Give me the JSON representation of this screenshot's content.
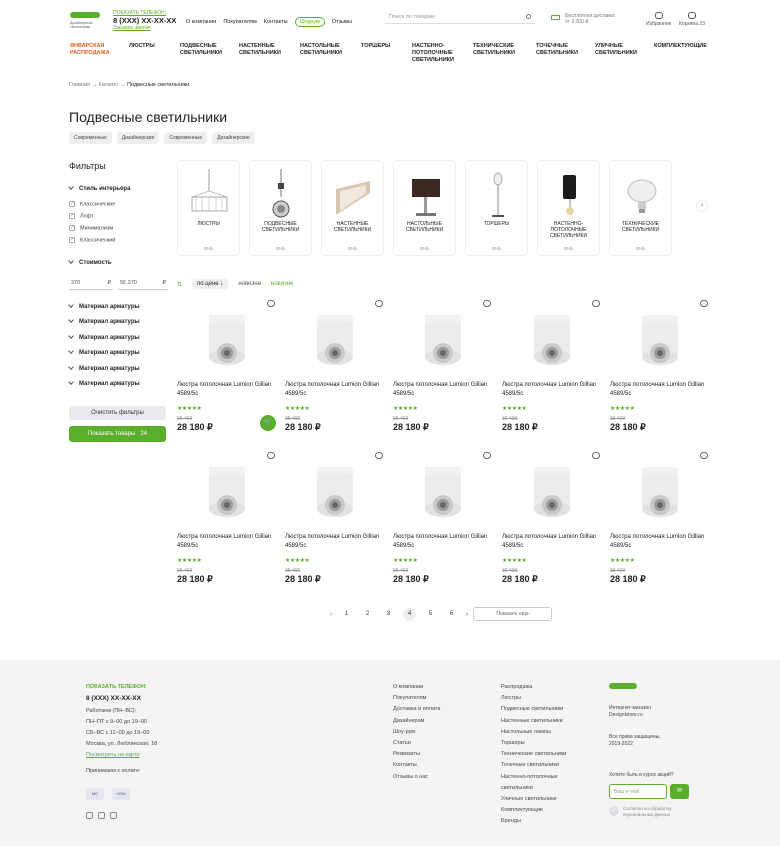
{
  "header": {
    "logo_sub": "Дизайнерские светильники",
    "phone_label": "ПОКАЗАТЬ ТЕЛЕФОН:",
    "phone": "8 (XXX) XX-XX-XX",
    "callback": "Заказать звонок",
    "nav": [
      "О компании",
      "Покупателям",
      "Контакты",
      "Шоурум",
      "Отзывы"
    ],
    "search_placeholder": "Поиск по товарам",
    "delivery": [
      "Бесплатная доставка",
      "от 3 000 ₽"
    ],
    "favorites": "Избранное",
    "cart": "Корзина 23"
  },
  "menu": [
    "ЯНВАРСКАЯ РАСПРОДАЖА",
    "ЛЮСТРЫ",
    "ПОДВЕСНЫЕ СВЕТИЛЬНИКИ",
    "НАСТЕННЫЕ СВЕТИЛЬНИКИ",
    "НАСТОЛЬНЫЕ СВЕТИЛЬНИКИ",
    "ТОРШЕРЫ",
    "НАСТЕННО-ПОТОЛОЧНЫЕ СВЕТИЛЬНИКИ",
    "ТЕХНИЧЕСКИЕ СВЕТИЛЬНИКИ",
    "ТОЧЕЧНЫЕ СВЕТИЛЬНИКИ",
    "УЛИЧНЫЕ СВЕТИЛЬНИКИ",
    "КОМПЛЕКТУЮЩИЕ"
  ],
  "breadcrumb": {
    "home": "Главная",
    "catalog": "Каталог",
    "current": "Подвесные светильники"
  },
  "title": "Подвесные светильники",
  "tags": [
    "Современные",
    "Дизайнерские",
    "Современные",
    "Дизайнерские"
  ],
  "filters": {
    "heading": "Фильтры",
    "style_group": "Стиль интерьера",
    "styles": [
      "Классические",
      "Лофт",
      "Минимализм",
      "Классический"
    ],
    "price_group": "Стоимость",
    "price_from": "370",
    "price_to": "56 370",
    "currency": "₽",
    "material_groups": [
      "Материал арматуры",
      "Материал арматуры",
      "Материал арматуры",
      "Материал арматуры",
      "Материал арматуры",
      "Материал арматуры"
    ],
    "clear": "Очистить фильтры",
    "show": "Показать товары",
    "show_count": "24"
  },
  "categories": [
    {
      "name": "ЛЮСТРЫ",
      "count": "384k"
    },
    {
      "name": "ПОДВЕСНЫЕ СВЕТИЛЬНИКИ",
      "count": "384k"
    },
    {
      "name": "НАСТЕННЫЕ СВЕТИЛЬНИКИ",
      "count": "384k"
    },
    {
      "name": "НАСТОЛЬНЫЕ СВЕТИЛЬНИКИ",
      "count": "384k"
    },
    {
      "name": "ТОРШЕРЫ",
      "count": "384k"
    },
    {
      "name": "НАСТЕННО-ПОТОЛОЧНЫЕ СВЕТИЛЬНИКИ",
      "count": "384k"
    },
    {
      "name": "ТЕХНИЧЕСКИЕ СВЕТИЛЬНИКИ",
      "count": "384k"
    }
  ],
  "sort": {
    "label": "по цене ↓",
    "newest": "новизне",
    "popular": "новизне"
  },
  "product": {
    "name": "Люстра потолочная Lumion Gillian 4589/5c",
    "stars": "★★★★★",
    "old_price": "35 490",
    "price": "28 180 ₽"
  },
  "pagination": {
    "pages": [
      "1",
      "2",
      "3",
      "4",
      "5",
      "6"
    ],
    "active": "4",
    "prev": "‹",
    "next": "›",
    "more": "Показать еще"
  },
  "footer": {
    "phone_label": "Показать телефон:",
    "phone": "8 (XXX) XX-XX-XX",
    "hours": [
      "Работаем (ПН–ВС):",
      "ПН–ПТ с 9–00 до 19–00",
      "СБ–ВС с 11–00 до 19–00",
      "Москва, ул. Люблинская, 18"
    ],
    "map": "Посмотреть на карте",
    "pay_label": "Принимаем к оплате:",
    "pay": [
      "MC",
      "VISA"
    ],
    "col2": [
      "О компании",
      "Покупателям",
      "Доставка и оплата",
      "Дизайнерам",
      "Шоу-рум",
      "Статьи",
      "Реквизиты",
      "Контакты",
      "Отзывы о нас"
    ],
    "col3": [
      "Распродажа",
      "Люстры",
      "Подвесные светильники",
      "Настенные светильники",
      "Настольные лампы",
      "Торшеры",
      "Технические светильники",
      "Точечные светильники",
      "Настенно-потолочные",
      "светильники",
      "Уличные светильники",
      "Комплектующие",
      "Бренды"
    ],
    "shop": [
      "Интернет-магазин",
      "Designlstore.ru"
    ],
    "rights": [
      "Все права защищены,",
      "2019-2022"
    ],
    "subscribe_q": "Хотите быть в курсе акций?",
    "email_placeholder": "Ваш e-mail",
    "agree": [
      "Согласен на обработку",
      "персональных данных"
    ]
  }
}
